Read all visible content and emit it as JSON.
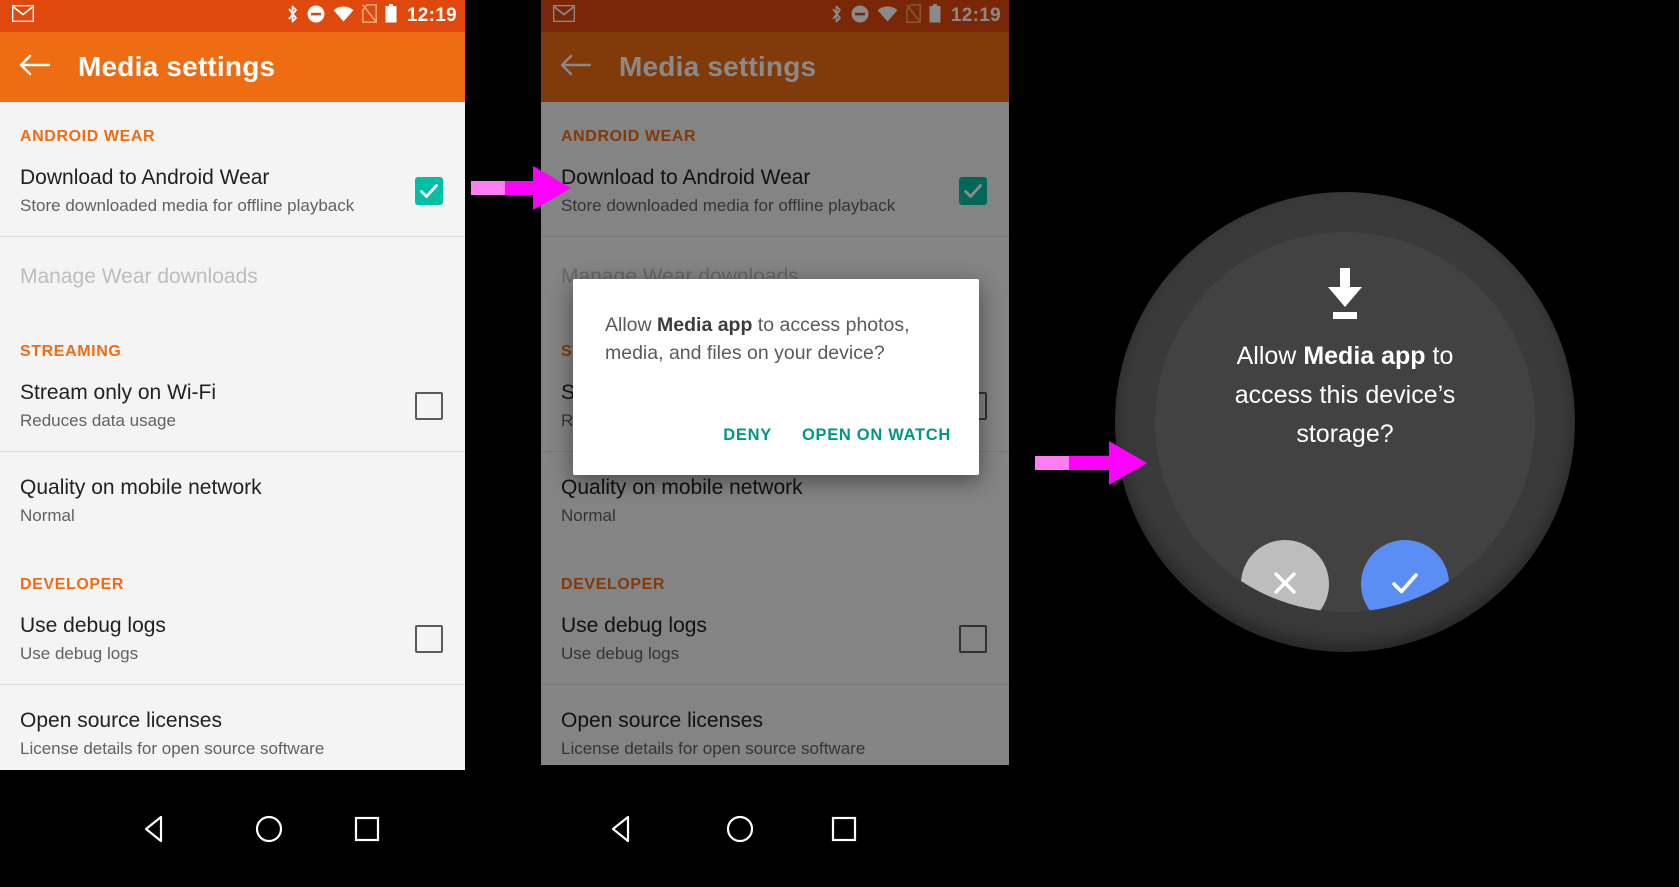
{
  "status_bar": {
    "app_icon": "gmail-icon",
    "icons": [
      "bluetooth-icon",
      "do-not-disturb-icon",
      "wifi-icon",
      "no-sim-icon",
      "battery-icon"
    ],
    "time": "12:19"
  },
  "app_bar": {
    "back_label": "back-arrow",
    "title": "Media settings"
  },
  "settings": {
    "sections": [
      {
        "header": "ANDROID WEAR",
        "rows": [
          {
            "title": "Download to Android Wear",
            "subtitle": "Store downloaded media for offline playback",
            "checkbox": "checked",
            "disabled": false
          },
          {
            "title": "Manage Wear downloads",
            "subtitle": "",
            "checkbox": "none",
            "disabled": true
          }
        ]
      },
      {
        "header": "STREAMING",
        "rows": [
          {
            "title": "Stream only on Wi-Fi",
            "subtitle": "Reduces data usage",
            "checkbox": "unchecked",
            "disabled": false
          },
          {
            "title": "Quality on mobile network",
            "subtitle": "Normal",
            "checkbox": "none",
            "disabled": false
          }
        ]
      },
      {
        "header": "DEVELOPER",
        "rows": [
          {
            "title": "Use debug logs",
            "subtitle": "Use debug logs",
            "checkbox": "unchecked",
            "disabled": false
          },
          {
            "title": "Open source licenses",
            "subtitle": "License details for open source software",
            "checkbox": "none",
            "disabled": false
          }
        ]
      }
    ]
  },
  "nav_bar": {
    "back": "back-triangle-icon",
    "home": "home-circle-icon",
    "recents": "recents-square-icon"
  },
  "dialog": {
    "message_before": "Allow ",
    "message_app": "Media app",
    "message_after": " to access photos, media, and files on your device?",
    "deny_label": "DENY",
    "confirm_label": "OPEN ON WATCH"
  },
  "watch": {
    "icon": "download-icon",
    "message_before": "Allow ",
    "message_app": "Media app",
    "message_after": "  to access this device’s storage?",
    "deny_label": "deny-x-icon",
    "allow_label": "allow-check-icon"
  },
  "arrows": [
    {
      "name": "arrow-phone-to-dialog"
    },
    {
      "name": "arrow-dialog-to-watch"
    }
  ],
  "colors": {
    "status_bar": "#e0490d",
    "app_bar": "#ee6c12",
    "section_header": "#ef6c14",
    "checkbox_on": "#00bfa5",
    "dialog_action": "#009688",
    "watch_allow": "#5b8ef4",
    "watch_deny": "#bdbdbd",
    "arrow": "#ff00ff"
  }
}
